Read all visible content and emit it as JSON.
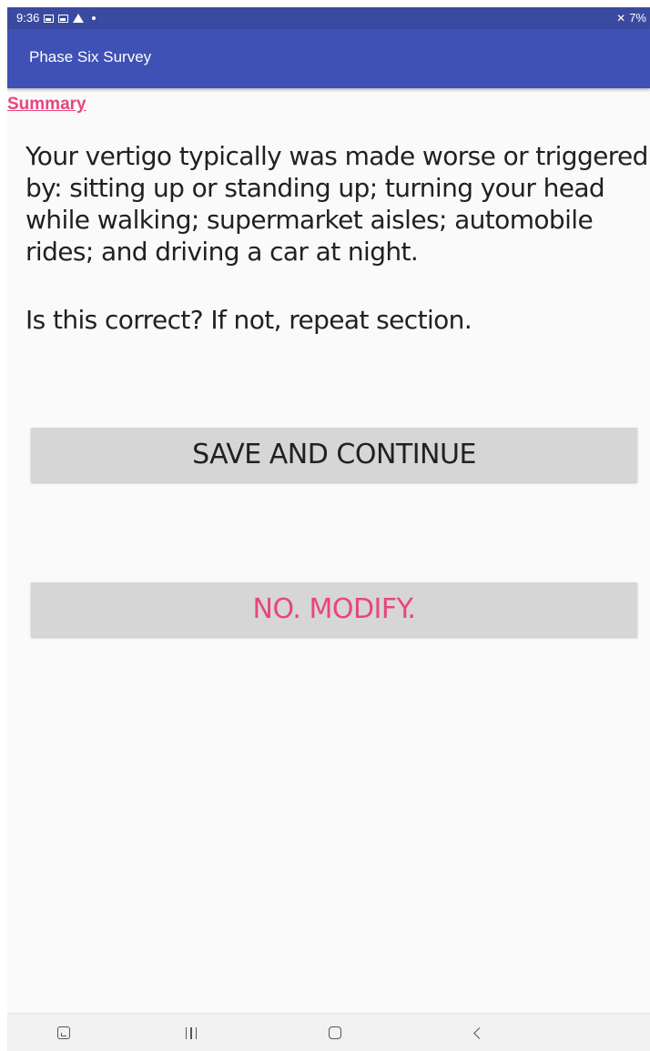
{
  "status_bar": {
    "time": "9:36",
    "battery": "7%"
  },
  "app_bar": {
    "title": "Phase Six Survey"
  },
  "summary": {
    "link_label": "Summary",
    "body": "Your vertigo typically was made worse or triggered by: sitting up or standing up; turning your head while walking; supermarket aisles; automobile rides; and driving a car at night.",
    "question": "Is this correct? If not, repeat section."
  },
  "actions": {
    "save_label": "SAVE AND CONTINUE",
    "modify_label": "NO. MODIFY."
  },
  "nav_bar": {
    "icons": [
      "recent-apps-icon",
      "menu-lines-icon",
      "home-icon",
      "back-icon"
    ]
  },
  "colors": {
    "app_bar": "#3f51b5",
    "accent": "#e8457f",
    "button_bg": "#d6d6d6"
  }
}
